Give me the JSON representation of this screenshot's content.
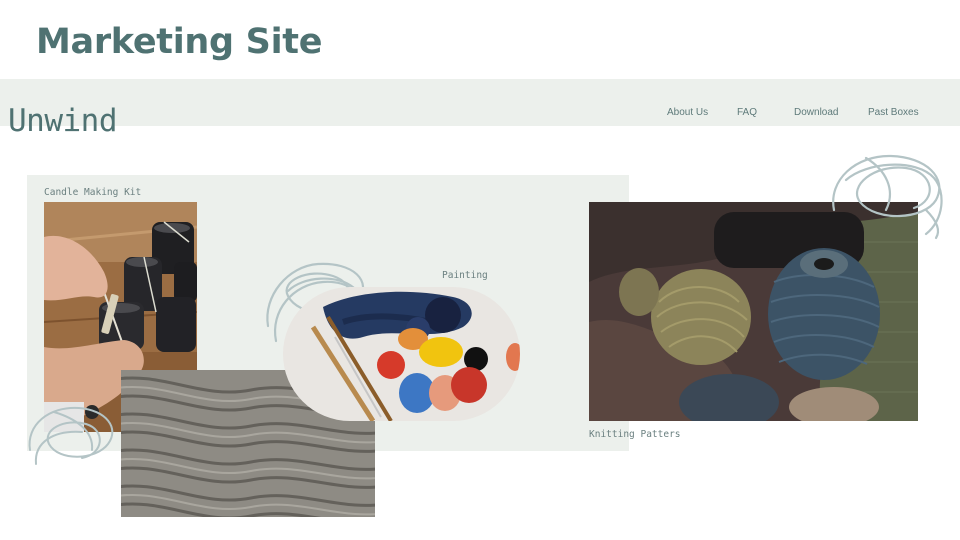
{
  "slide": {
    "title": "Marketing Site"
  },
  "site": {
    "brand": "Unwind",
    "nav": [
      "About Us",
      "FAQ",
      "Download",
      "Past Boxes"
    ]
  },
  "features": {
    "candle": "Candle Making Kit",
    "painting": "Painting",
    "knitting": "Knitting Patters"
  },
  "colors": {
    "title": "#4f7272",
    "band": "#ecf0ec",
    "scribble": "#b4c4c6"
  },
  "icons": [
    "scribble-doodle"
  ]
}
